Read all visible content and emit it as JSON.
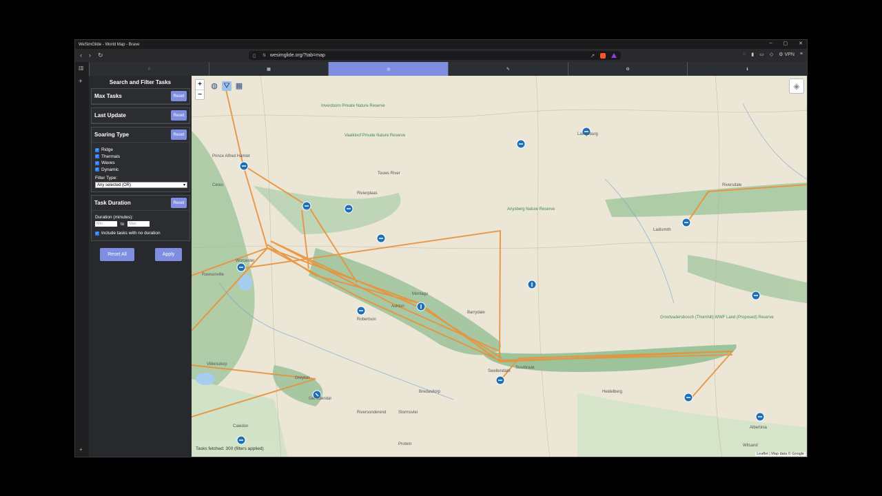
{
  "window": {
    "title": "WeSimGlide - World Map - Brave",
    "url": "wesimglide.org/?tab=map"
  },
  "browser": {
    "vpn_label": "VPN"
  },
  "tabs": [
    {
      "icon": "home-icon",
      "glyph": "⌂"
    },
    {
      "icon": "calendar-icon",
      "glyph": "▦"
    },
    {
      "icon": "globe-icon",
      "glyph": "◍"
    },
    {
      "icon": "tools-icon",
      "glyph": "✎"
    },
    {
      "icon": "gear-icon",
      "glyph": "⚙"
    },
    {
      "icon": "info-icon",
      "glyph": "ℹ"
    }
  ],
  "sidebar": {
    "title": "Search and Filter Tasks",
    "reset_label": "Reset",
    "max_tasks": {
      "label": "Max Tasks"
    },
    "last_update": {
      "label": "Last Update"
    },
    "soaring_type": {
      "label": "Soaring Type",
      "options": [
        {
          "label": "Ridge",
          "checked": true
        },
        {
          "label": "Thermals",
          "checked": true
        },
        {
          "label": "Waves",
          "checked": true
        },
        {
          "label": "Dynamic",
          "checked": true
        }
      ],
      "filter_type_label": "Filter Type:",
      "filter_type_value": "Any selected (OR)"
    },
    "task_duration": {
      "label": "Task Duration",
      "duration_label": "Duration (minutes):",
      "min_placeholder": "Min",
      "to_label": "to",
      "max_placeholder": "Max",
      "no_duration_label": "Include tasks with no duration"
    },
    "reset_all_label": "Reset All",
    "apply_label": "Apply"
  },
  "map": {
    "status": "Tasks fetched: 300 (filters applied)",
    "attribution": "Leaflet | Map data © Google",
    "places": [
      "Inverdoorn Private Nature Reserve",
      "Vaalkloof Private Nature Reserve",
      "Anysberg Nature Reserve",
      "Grootvadersbosch (Thornhill) WWF Land (Proposed) Reserve",
      "Prince Alfred Hamlet",
      "Ceres",
      "Worcester",
      "Rawsonville",
      "Robertson",
      "Montagu",
      "Ashton",
      "Swellendam",
      "Heidelberg",
      "Riversonderend",
      "Caledon",
      "Villiersdorp",
      "Touws River",
      "Laingsburg",
      "Ladismith",
      "Barrydale",
      "Suurbraak",
      "Rivierplaas",
      "Albertinia",
      "Riversdale",
      "Bredasdorp",
      "Stormsvlei",
      "Greyton",
      "Genadendal",
      "Protem",
      "Witsand"
    ],
    "colors": {
      "task_line": "#e8923a",
      "marker": "#1f6fb8"
    }
  }
}
